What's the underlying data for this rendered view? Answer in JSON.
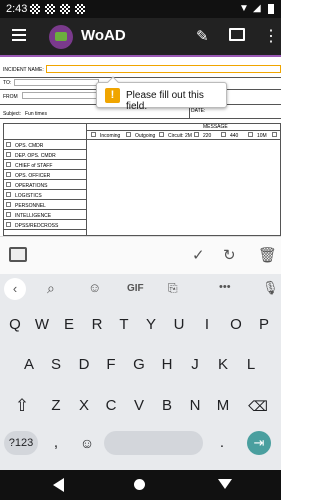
{
  "status": {
    "time": "2:43"
  },
  "app": {
    "title": "WoAD"
  },
  "form": {
    "incident_name_label": "INCIDENT NAME:",
    "to_label": "TO:",
    "from_label": "FROM",
    "subject_label": "Subject:",
    "subject_value": "Fun times",
    "date_label": "DATE:",
    "message_label": "MESSAGE",
    "columns": [
      "Incoming",
      "Outgoing",
      "Circuit: 2M",
      "220",
      "440",
      "10M"
    ],
    "positions": [
      "OPS. CMDR",
      "DEP. OPS. CMDR",
      "CHIEF of STAFF",
      "OPS. OFFICER",
      "OPERATIONS",
      "LOGISTICS",
      "PERSONNEL",
      "INTELLIGENCE",
      "DPSS/REDCROSS"
    ]
  },
  "tooltip": {
    "message": "Please fill out this field."
  },
  "keyboard": {
    "tools": {
      "gif_label": "GIF",
      "more_label": "•••"
    },
    "row1": [
      "Q",
      "W",
      "E",
      "R",
      "T",
      "Y",
      "U",
      "I",
      "O",
      "P"
    ],
    "row2": [
      "A",
      "S",
      "D",
      "F",
      "G",
      "H",
      "J",
      "K",
      "L"
    ],
    "row3": [
      "Z",
      "X",
      "C",
      "V",
      "B",
      "N",
      "M"
    ],
    "symbols_label": "?123",
    "comma": ",",
    "period": "."
  }
}
